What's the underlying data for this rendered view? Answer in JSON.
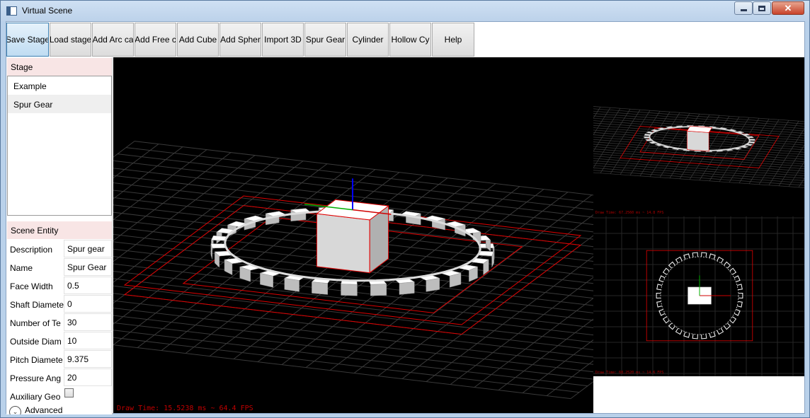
{
  "window": {
    "title": "Virtual Scene",
    "minimize_icon": "minimize-icon",
    "maximize_icon": "maximize-icon",
    "close_icon": "close-icon",
    "close_glyph": "✕"
  },
  "toolbar": {
    "buttons": [
      {
        "label": "Save Stage",
        "active": true
      },
      {
        "label": "Load stage"
      },
      {
        "label": "Add Arc ca"
      },
      {
        "label": "Add Free c"
      },
      {
        "label": "Add Cube"
      },
      {
        "label": "Add Spher"
      },
      {
        "label": "Import 3D"
      },
      {
        "label": "Spur Gear"
      },
      {
        "label": "Cylinder"
      },
      {
        "label": "Hollow Cy"
      },
      {
        "label": "Help"
      }
    ]
  },
  "stage": {
    "header": "Stage",
    "items": [
      {
        "label": "Example"
      },
      {
        "label": "Spur Gear",
        "selected": true
      }
    ]
  },
  "entity": {
    "header": "Scene Entity",
    "properties": [
      {
        "label": "Description",
        "value": "Spur gear"
      },
      {
        "label": "Name",
        "value": "Spur Gear"
      },
      {
        "label": "Face Width",
        "value": "0.5"
      },
      {
        "label": "Shaft Diamete",
        "value": "0"
      },
      {
        "label": "Number of Te",
        "value": "30"
      },
      {
        "label": "Outside Diam",
        "value": "10"
      },
      {
        "label": "Pitch Diamete",
        "value": "9.375"
      },
      {
        "label": "Pressure Ang",
        "value": "20"
      }
    ],
    "auxiliary_label": "Auxiliary Geo",
    "auxiliary_checked": false,
    "advanced_label": "Advanced",
    "advanced_icon": "chevron-down-icon",
    "advanced_glyph": "⌄"
  },
  "viewport": {
    "status": "Draw Time: 15.5238 ms ~ 64.4 FPS",
    "top_status": "Draw Time: 67.2560 ms ~ 14.8 FPS",
    "plan_status": "Draw Time: 68.2520 ms ~ 14.6 FPS",
    "gear_teeth": 30,
    "colors": {
      "background": "#000000",
      "grid": "#3a3a3a",
      "bounds": "#e00000",
      "x_axis": "#d00000",
      "y_axis": "#00b000",
      "z_axis": "#0000ff",
      "model": "#ffffff"
    }
  }
}
